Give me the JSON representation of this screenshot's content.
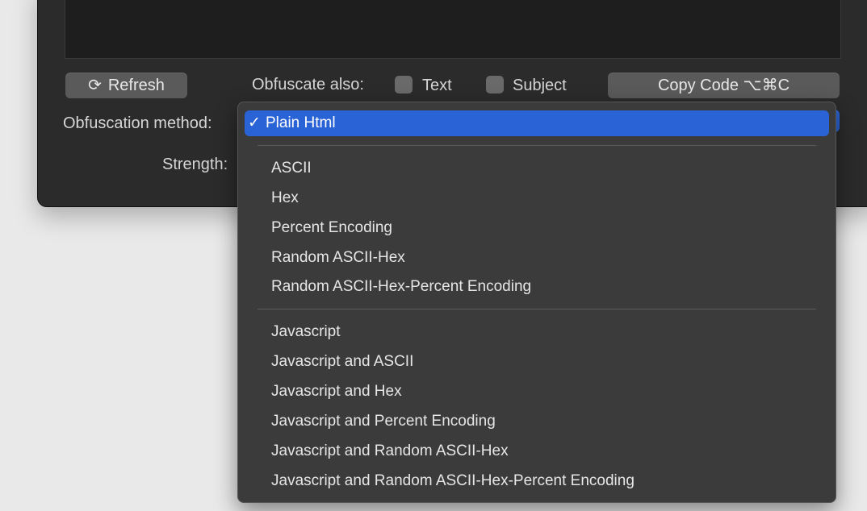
{
  "toolbar": {
    "refresh_label": "Refresh",
    "refresh_icon": "⟳",
    "obfuscate_also_label": "Obfuscate also:",
    "text_label": "Text",
    "subject_label": "Subject",
    "copy_label": "Copy Code  ⌥⌘C"
  },
  "form": {
    "obfuscation_method_label": "Obfuscation method:",
    "strength_label": "Strength:"
  },
  "menu": {
    "check_mark": "✓",
    "selected": "Plain Html",
    "group1": [
      "ASCII",
      "Hex",
      "Percent Encoding",
      "Random ASCII-Hex",
      "Random ASCII-Hex-Percent Encoding"
    ],
    "group2": [
      "Javascript",
      "Javascript and ASCII",
      "Javascript and Hex",
      "Javascript and Percent Encoding",
      "Javascript and Random ASCII-Hex",
      "Javascript and Random ASCII-Hex-Percent Encoding"
    ]
  },
  "colors": {
    "accent": "#2a63d6",
    "window": "#2b2b2b",
    "menu": "#3b3b3b"
  }
}
